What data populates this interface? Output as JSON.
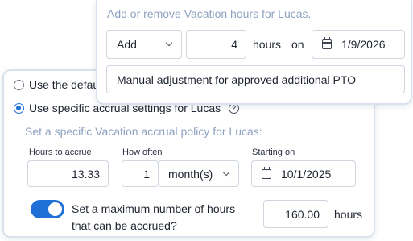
{
  "accrual_panel": {
    "default_option_label": "Use the defau",
    "specific_option_label": "Use specific accrual settings for Lucas",
    "help_icon": "question-circle-icon",
    "policy_hint": "Set a specific Vacation accrual policy for Lucas:",
    "hours_to_accrue_label": "Hours to accrue",
    "hours_to_accrue_value": "13.33",
    "how_often_label": "How often",
    "how_often_number": "1",
    "how_often_unit": "month(s)",
    "starting_on_label": "Starting on",
    "starting_on_value": "10/1/2025",
    "max_toggle_on": true,
    "max_label_line1": "Set a maximum number of hours",
    "max_label_line2": "that can be accrued?",
    "max_value": "160.00",
    "max_unit": "hours"
  },
  "adjust_panel": {
    "hint": "Add or remove Vacation hours for Lucas.",
    "action_value": "Add",
    "hours_value": "4",
    "hours_label": "hours",
    "on_label": "on",
    "date_value": "1/9/2026",
    "note_value": "Manual adjustment for approved additional PTO"
  },
  "colors": {
    "accent": "#1f6fd6",
    "hint": "#8fa3c0",
    "border": "#cfd6df"
  }
}
